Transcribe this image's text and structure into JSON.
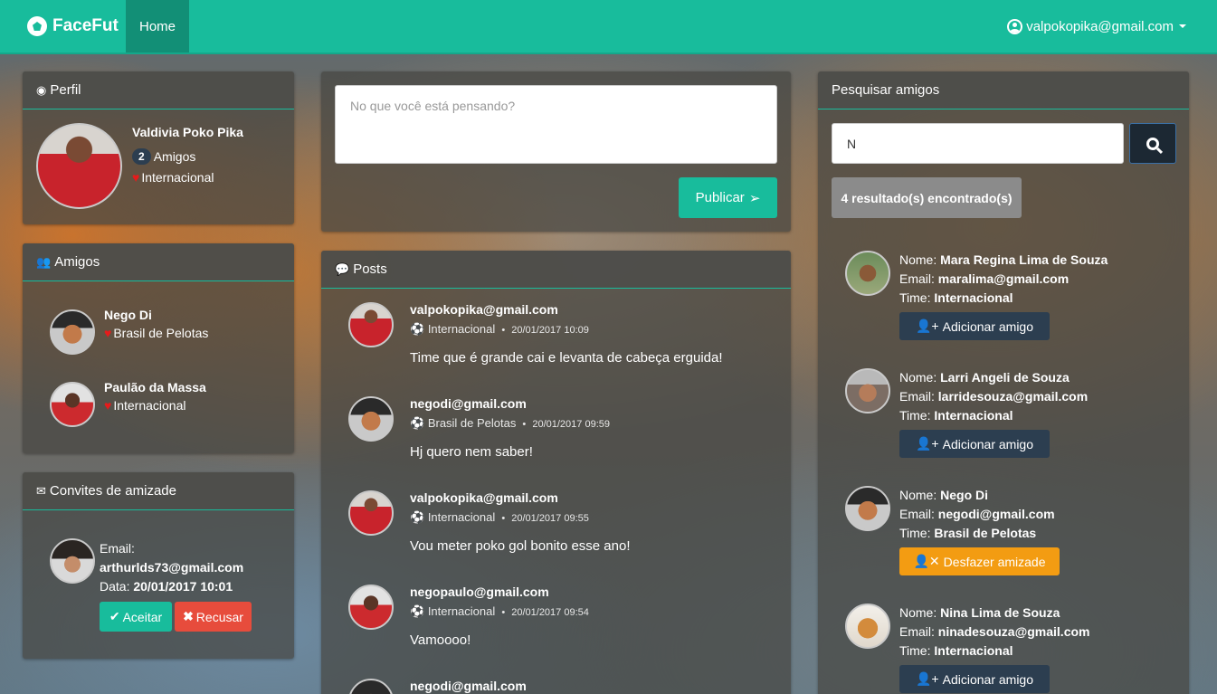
{
  "navbar": {
    "brand": "FaceFut",
    "home": "Home",
    "user_email": "valpokopika@gmail.com"
  },
  "profile": {
    "heading": "Perfil",
    "name": "Valdivia Poko Pika",
    "friends_count": "2",
    "friends_label": "Amigos",
    "team": "Internacional"
  },
  "friends": {
    "heading": "Amigos",
    "items": [
      {
        "name": "Nego Di",
        "team": "Brasil de Pelotas"
      },
      {
        "name": "Paulão da Massa",
        "team": "Internacional"
      }
    ]
  },
  "invites": {
    "heading": "Convites de amizade",
    "email_label": "Email:",
    "email": "arthurlds73@gmail.com",
    "date_label": "Data:",
    "date": "20/01/2017 10:01",
    "accept": "Aceitar",
    "reject": "Recusar"
  },
  "composer": {
    "placeholder": "No que você está pensando?",
    "publish": "Publicar"
  },
  "posts": {
    "heading": "Posts",
    "items": [
      {
        "email": "valpokopika@gmail.com",
        "team": "Internacional",
        "date": "20/01/2017 10:09",
        "text": "Time que é grande cai e levanta de cabeça erguida!"
      },
      {
        "email": "negodi@gmail.com",
        "team": "Brasil de Pelotas",
        "date": "20/01/2017 09:59",
        "text": "Hj quero nem saber!"
      },
      {
        "email": "valpokopika@gmail.com",
        "team": "Internacional",
        "date": "20/01/2017 09:55",
        "text": "Vou meter poko gol bonito esse ano!"
      },
      {
        "email": "negopaulo@gmail.com",
        "team": "Internacional",
        "date": "20/01/2017 09:54",
        "text": "Vamoooo!"
      },
      {
        "email": "negodi@gmail.com",
        "team": "",
        "date": "",
        "text": ""
      }
    ]
  },
  "search": {
    "heading": "Pesquisar amigos",
    "query": "N",
    "result_count": "4 resultado(s) encontrado(s)",
    "labels": {
      "name": "Nome:",
      "email": "Email:",
      "team": "Time:"
    },
    "results": [
      {
        "name": "Mara Regina Lima de Souza",
        "email": "maralima@gmail.com",
        "team": "Internacional",
        "action": "Adicionar amigo"
      },
      {
        "name": "Larri Angeli de Souza",
        "email": "larridesouza@gmail.com",
        "team": "Internacional",
        "action": "Adicionar amigo"
      },
      {
        "name": "Nego Di",
        "email": "negodi@gmail.com",
        "team": "Brasil de Pelotas",
        "action": "Desfazer amizade"
      },
      {
        "name": "Nina Lima de Souza",
        "email": "ninadesouza@gmail.com",
        "team": "Internacional",
        "action": "Adicionar amigo"
      }
    ]
  }
}
